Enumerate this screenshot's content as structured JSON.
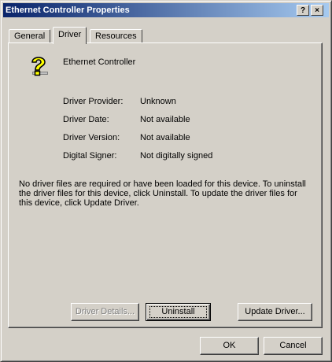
{
  "window": {
    "title": "Ethernet Controller Properties"
  },
  "title_buttons": {
    "help": "?",
    "close": "×"
  },
  "tabs": [
    {
      "label": "General"
    },
    {
      "label": "Driver"
    },
    {
      "label": "Resources"
    }
  ],
  "device": {
    "name": "Ethernet Controller",
    "icon": "unknown-device-icon"
  },
  "driver_info": {
    "provider_label": "Driver Provider:",
    "provider_value": "Unknown",
    "date_label": "Driver Date:",
    "date_value": "Not available",
    "version_label": "Driver Version:",
    "version_value": "Not available",
    "signer_label": "Digital Signer:",
    "signer_value": "Not digitally signed"
  },
  "description": "No driver files are required or have been loaded for this device. To uninstall the driver files for this device, click Uninstall. To update the driver files for this device, click Update Driver.",
  "buttons": {
    "driver_details": "Driver Details...",
    "uninstall": "Uninstall",
    "update_driver": "Update Driver...",
    "ok": "OK",
    "cancel": "Cancel"
  },
  "colors": {
    "face": "#d4d0c8",
    "title_start": "#0a246a",
    "title_end": "#a6caf0",
    "icon_yellow": "#ffff00"
  }
}
